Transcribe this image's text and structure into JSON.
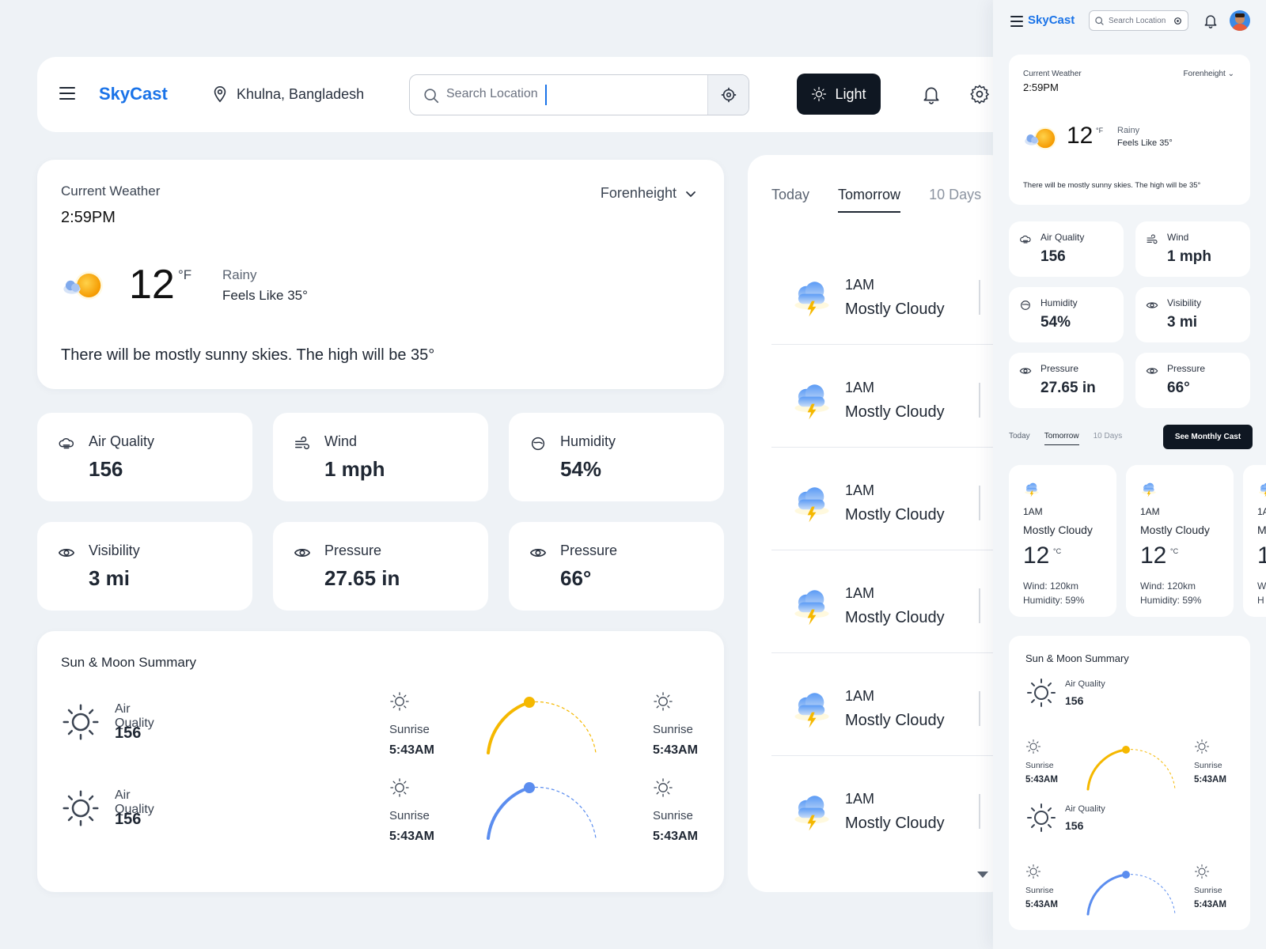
{
  "header": {
    "brand": "SkyCast",
    "location": "Khulna, Bangladesh",
    "search_placeholder": "Search Location",
    "theme_label": "Light"
  },
  "current_weather": {
    "label": "Current Weather",
    "time": "2:59PM",
    "unit_selector": "Forenheight",
    "temperature": "12",
    "temp_unit": "°F",
    "condition": "Rainy",
    "feels_like": "Feels Like 35°",
    "description": "There will be mostly sunny skies. The high will be 35°"
  },
  "metrics": [
    {
      "label": "Air Quality",
      "value": "156",
      "icon": "air-quality-icon"
    },
    {
      "label": "Wind",
      "value": "1 mph",
      "icon": "wind-icon"
    },
    {
      "label": "Humidity",
      "value": "54%",
      "icon": "humidity-icon"
    },
    {
      "label": "Visibility",
      "value": "3 mi",
      "icon": "eye-icon"
    },
    {
      "label": "Pressure",
      "value": "27.65 in",
      "icon": "eye-icon"
    },
    {
      "label": "Pressure",
      "value": "66°",
      "icon": "eye-icon"
    }
  ],
  "sun_moon": {
    "title": "Sun & Moon Summary",
    "items": [
      {
        "label": "Air Quality",
        "value": "156"
      },
      {
        "label": "Air Quality",
        "value": "156"
      }
    ],
    "rise_set": [
      {
        "label": "Sunrise",
        "time": "5:43AM"
      },
      {
        "label": "Sunrise",
        "time": "5:43AM"
      },
      {
        "label": "Sunrise",
        "time": "5:43AM"
      },
      {
        "label": "Sunrise",
        "time": "5:43AM"
      }
    ],
    "arc_colors": [
      "#f5b800",
      "#5b8def"
    ]
  },
  "forecast": {
    "tabs": [
      "Today",
      "Tomorrow",
      "10 Days"
    ],
    "active_tab": "Tomorrow",
    "rows": [
      {
        "time": "1AM",
        "condition": "Mostly Cloudy"
      },
      {
        "time": "1AM",
        "condition": "Mostly Cloudy"
      },
      {
        "time": "1AM",
        "condition": "Mostly Cloudy"
      },
      {
        "time": "1AM",
        "condition": "Mostly Cloudy"
      },
      {
        "time": "1AM",
        "condition": "Mostly Cloudy"
      },
      {
        "time": "1AM",
        "condition": "Mostly Cloudy"
      }
    ]
  },
  "mobile": {
    "brand": "SkyCast",
    "search_placeholder": "Search Location",
    "current_label": "Current Weather",
    "time": "2:59PM",
    "unit_selector": "Forenheight",
    "temperature": "12",
    "temp_unit": "°F",
    "condition": "Rainy",
    "feels_like": "Feels Like 35°",
    "description": "There will be mostly sunny skies. The high will be 35°",
    "metrics": [
      {
        "label": "Air Quality",
        "value": "156"
      },
      {
        "label": "Wind",
        "value": "1 mph"
      },
      {
        "label": "Humidity",
        "value": "54%"
      },
      {
        "label": "Visibility",
        "value": "3 mi"
      },
      {
        "label": "Pressure",
        "value": "27.65 in"
      },
      {
        "label": "Pressure",
        "value": "66°"
      }
    ],
    "tabs": [
      "Today",
      "Tomorrow",
      "10 Days"
    ],
    "monthly_button": "See Monthly Cast",
    "forecast_cards": [
      {
        "time": "1AM",
        "condition": "Mostly Cloudy",
        "temp": "12",
        "unit": "°C",
        "wind": "Wind: 120km",
        "humidity": "Humidity: 59%"
      },
      {
        "time": "1AM",
        "condition": "Mostly Cloudy",
        "temp": "12",
        "unit": "°C",
        "wind": "Wind: 120km",
        "humidity": "Humidity: 59%"
      },
      {
        "time": "1A",
        "condition": "M",
        "temp": "1",
        "unit": "",
        "wind": "W",
        "humidity": "H"
      }
    ],
    "sun_moon_title": "Sun & Moon Summary",
    "sun_items": [
      {
        "label": "Air Quality",
        "value": "156"
      },
      {
        "label": "Air Quality",
        "value": "156"
      }
    ],
    "rise_set": [
      {
        "label": "Sunrise",
        "time": "5:43AM"
      },
      {
        "label": "Sunrise",
        "time": "5:43AM"
      },
      {
        "label": "Sunrise",
        "time": "5:43AM"
      },
      {
        "label": "Sunrise",
        "time": "5:43AM"
      }
    ]
  }
}
